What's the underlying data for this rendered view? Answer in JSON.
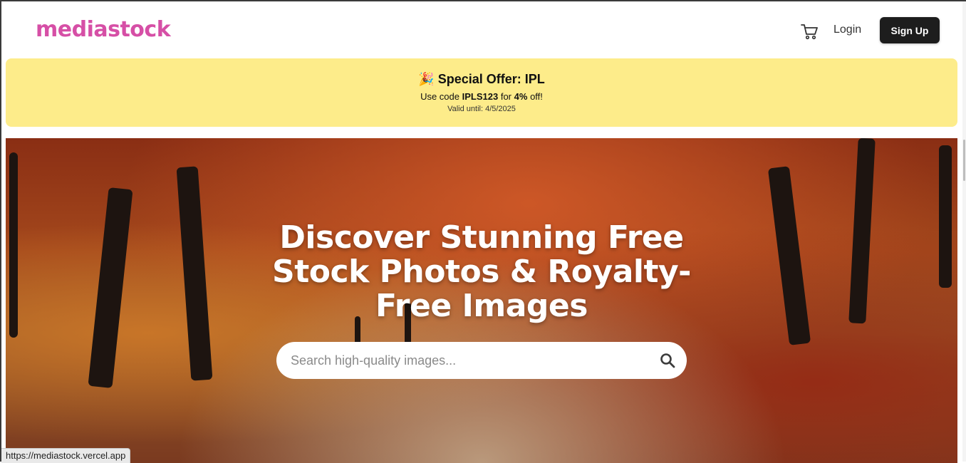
{
  "header": {
    "logo": "mediastock",
    "login_label": "Login",
    "signup_label": "Sign Up",
    "cart_icon": "cart-icon"
  },
  "offer": {
    "emoji": "🎉",
    "title": "Special Offer: IPL",
    "code_prefix": "Use code",
    "code": "IPLS123",
    "code_mid": "for",
    "discount": "4%",
    "code_suffix": "off!",
    "valid_label": "Valid until: 4/5/2025",
    "background": "#fdec8a"
  },
  "hero": {
    "title": "Discover Stunning Free Stock Photos & Royalty-Free Images",
    "search_placeholder": "Search high-quality images...",
    "search_icon": "search-icon"
  },
  "statusbar": {
    "url": "https://mediastock.vercel.app"
  },
  "colors": {
    "brand": "#d64fa6",
    "button_dark": "#1d1d1d"
  }
}
